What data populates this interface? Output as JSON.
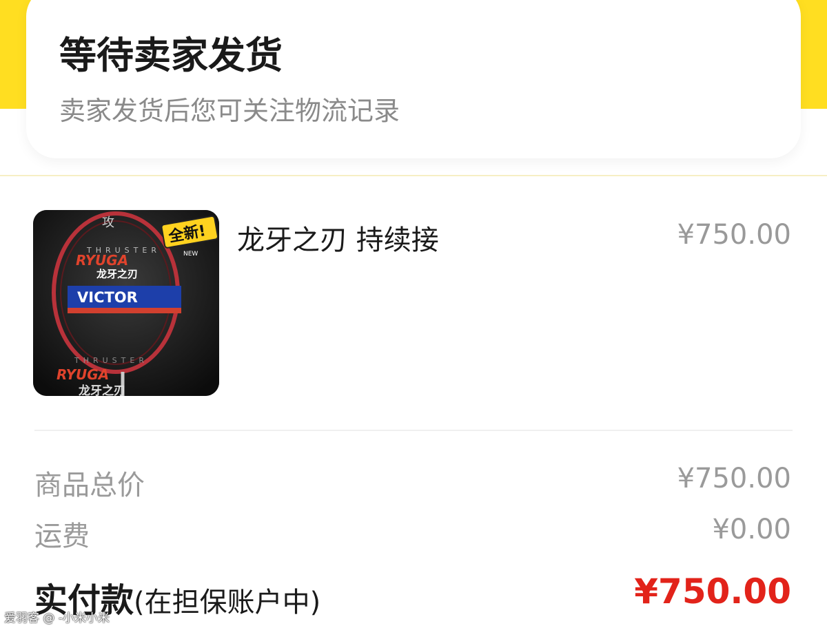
{
  "order_status": {
    "title": "等待卖家发货",
    "subtitle": "卖家发货后您可关注物流记录"
  },
  "product": {
    "name": "龙牙之刃 持续接",
    "price": "¥750.00",
    "image_icon": "badminton-racket-image",
    "image_texts": {
      "badge": "全新!",
      "badge_sub": "NEW",
      "series": "THRUSTER",
      "model": "RYUGA",
      "model_cn": "龙牙之刃",
      "brand": "VICTOR",
      "glyph": "攻"
    }
  },
  "summary": {
    "goods_total_label": "商品总价",
    "goods_total_value": "¥750.00",
    "shipping_label": "运费",
    "shipping_value": "¥0.00",
    "paid_label": "实付款",
    "paid_note": "(在担保账户中)",
    "paid_value": "¥750.00"
  },
  "watermark": "爱羽客 @ -小米小米",
  "colors": {
    "accent_yellow": "#ffde21",
    "price_red": "#e2231a",
    "muted_text": "#9a9a9a"
  }
}
